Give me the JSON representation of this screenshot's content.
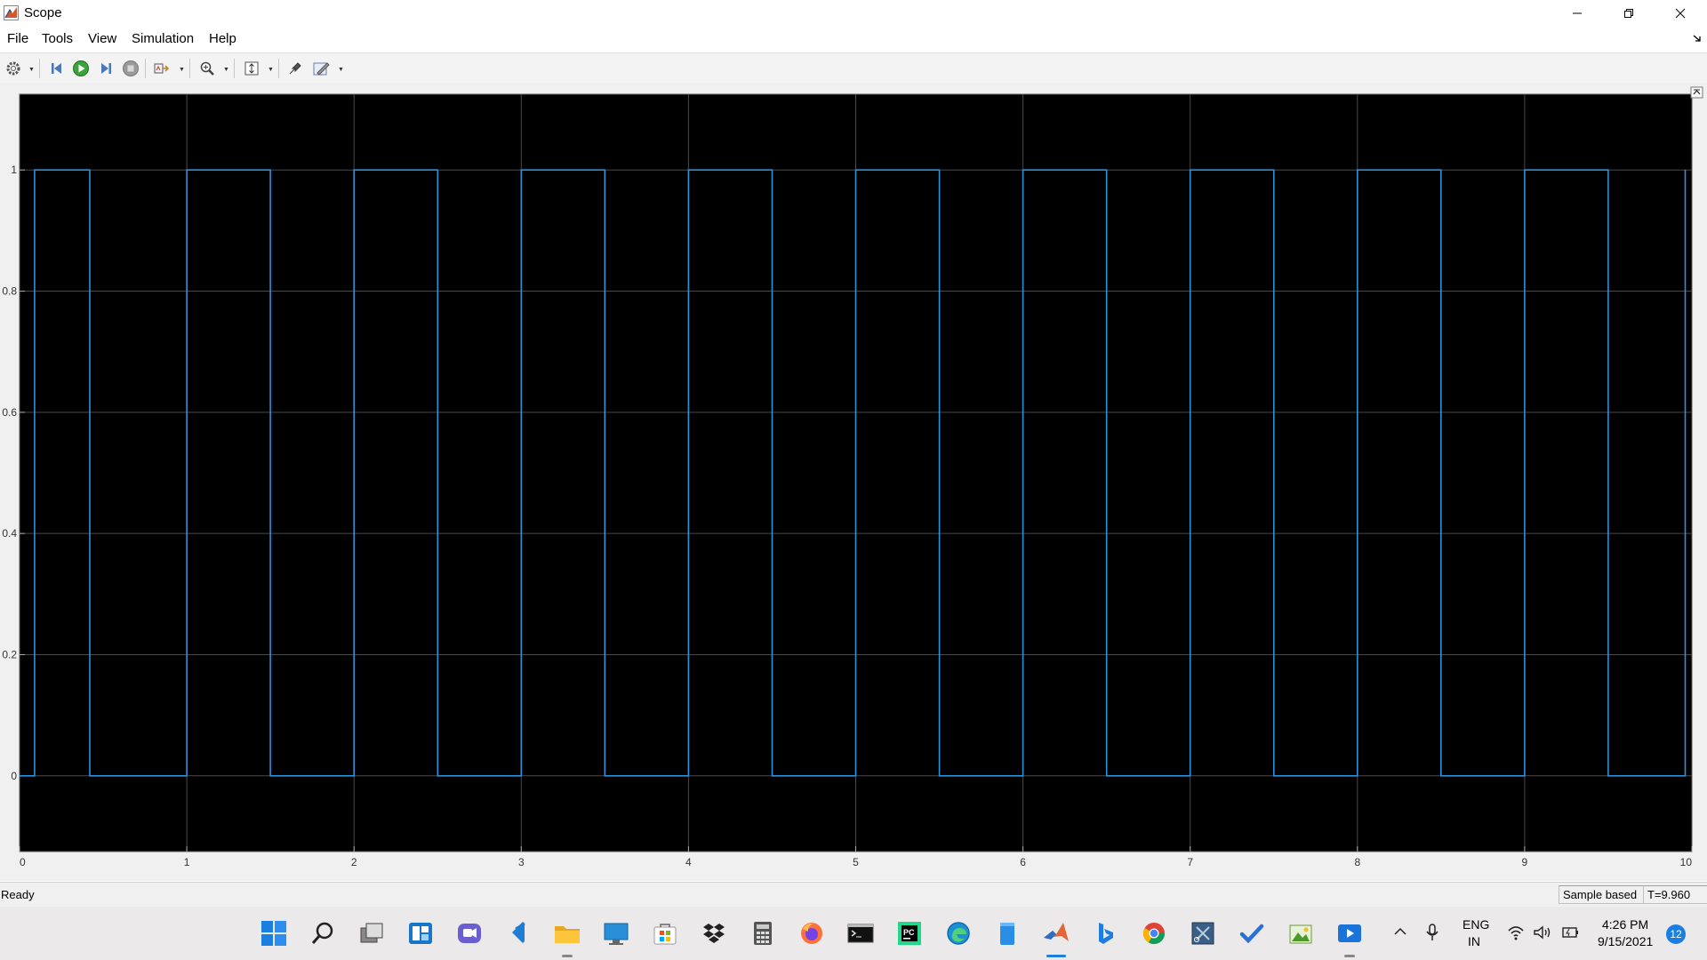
{
  "window": {
    "title": "Scope"
  },
  "menu": [
    "File",
    "Tools",
    "View",
    "Simulation",
    "Help"
  ],
  "toolbar": {
    "icons": [
      "settings-icon",
      "step-back-icon",
      "run-icon",
      "step-forward-icon",
      "stop-icon",
      "signal-selector-icon",
      "zoom-in-icon",
      "scale-axes-icon",
      "highlight-simulink-block-icon",
      "style-icon"
    ]
  },
  "chart_data": {
    "type": "line",
    "title": "",
    "xlabel": "",
    "ylabel": "",
    "xlim": [
      0,
      10
    ],
    "ylim": [
      -0.125,
      1.125
    ],
    "x_ticks": [
      "0",
      "1",
      "2",
      "3",
      "4",
      "5",
      "6",
      "7",
      "8",
      "9",
      "10"
    ],
    "y_ticks": [
      "0",
      "0.2",
      "0.4",
      "0.6",
      "0.8",
      "1"
    ],
    "grid": true,
    "background": "#000000",
    "series": [
      {
        "color": "#2f8fd8",
        "x": [
          0,
          0.09,
          0.09,
          0.42,
          0.42,
          1.0,
          1.0,
          1.5,
          1.5,
          2.0,
          2.0,
          2.5,
          2.5,
          3.0,
          3.0,
          3.5,
          3.5,
          4.0,
          4.0,
          4.5,
          4.5,
          5.0,
          5.0,
          5.5,
          5.5,
          6.0,
          6.0,
          6.5,
          6.5,
          7.0,
          7.0,
          7.5,
          7.5,
          8.0,
          8.0,
          8.5,
          8.5,
          9.0,
          9.0,
          9.5,
          9.5,
          9.96,
          9.96
        ],
        "y": [
          0,
          0,
          1,
          1,
          0,
          0,
          1,
          1,
          0,
          0,
          1,
          1,
          0,
          0,
          1,
          1,
          0,
          0,
          1,
          1,
          0,
          0,
          1,
          1,
          0,
          0,
          1,
          1,
          0,
          0,
          1,
          1,
          0,
          0,
          1,
          1,
          0,
          0,
          1,
          1,
          0,
          0,
          1
        ]
      }
    ]
  },
  "status": {
    "text": "Ready",
    "mode": "Sample based",
    "time": "T=9.960"
  },
  "taskbar": {
    "icons": [
      "windows-start-icon",
      "search-icon",
      "task-view-icon",
      "widgets-icon",
      "chat-icon",
      "vscode-icon",
      "file-explorer-icon",
      "remote-desktop-icon",
      "microsoft-store-icon",
      "dropbox-icon",
      "calculator-icon",
      "firefox-icon",
      "terminal-icon",
      "pycharm-icon",
      "edge-icon",
      "notepad-icon",
      "matlab-icon",
      "bing-icon",
      "chrome-icon",
      "snipping-tool-icon",
      "todo-icon",
      "photos-icon",
      "media-player-icon"
    ]
  },
  "tray": {
    "lang1": "ENG",
    "lang2": "IN",
    "time": "4:26 PM",
    "date": "9/15/2021",
    "notifications": "12"
  }
}
